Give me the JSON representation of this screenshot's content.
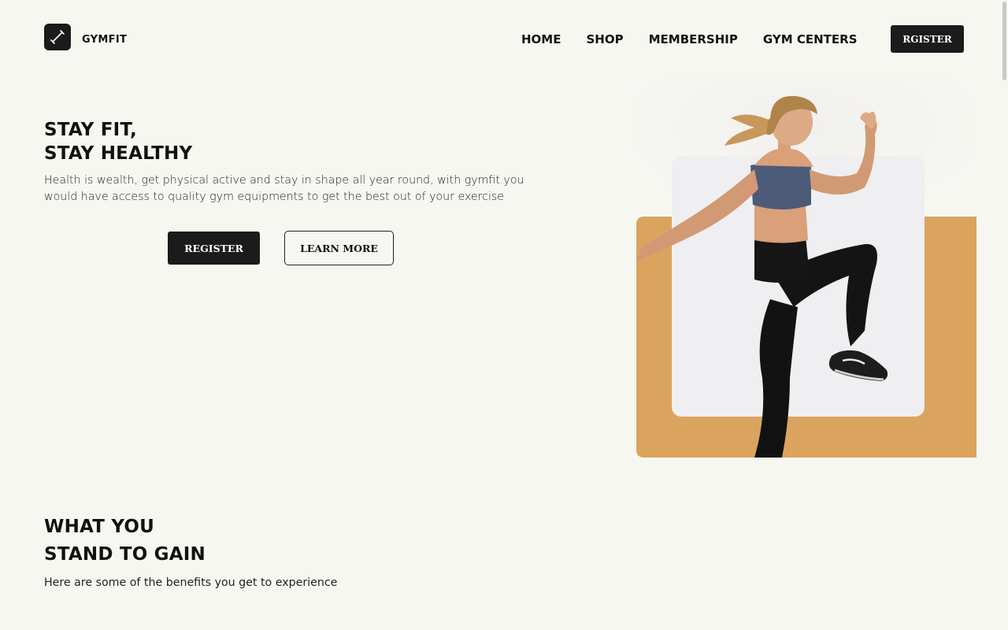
{
  "brand": {
    "name": "GYMFIT",
    "logo_icon": "dumbbell-slash-icon"
  },
  "nav": {
    "items": [
      "HOME",
      "SHOP",
      "MEMBERSHIP",
      "GYM CENTERS"
    ],
    "register_label": "RGISTER"
  },
  "hero": {
    "title_line1": "STAY FIT,",
    "title_line2": "STAY HEALTHY",
    "description": "Health is wealth, get physical active and stay in shape all year round, with gymfit you would have access to quality gym equipments to get the best out of your exercise",
    "register_label": "REGISTER",
    "learn_more_label": "LEARN MORE",
    "image": "woman-high-knee-exercise-photo"
  },
  "benefits": {
    "title_line1": "WHAT YOU",
    "title_line2": "STAND TO GAIN",
    "description": "Here are some of the benefits you get to experience"
  },
  "colors": {
    "background": "#f7f7f2",
    "dark": "#1b1b1b",
    "accent_orange": "#dba45e",
    "card_light": "#efeef0"
  }
}
